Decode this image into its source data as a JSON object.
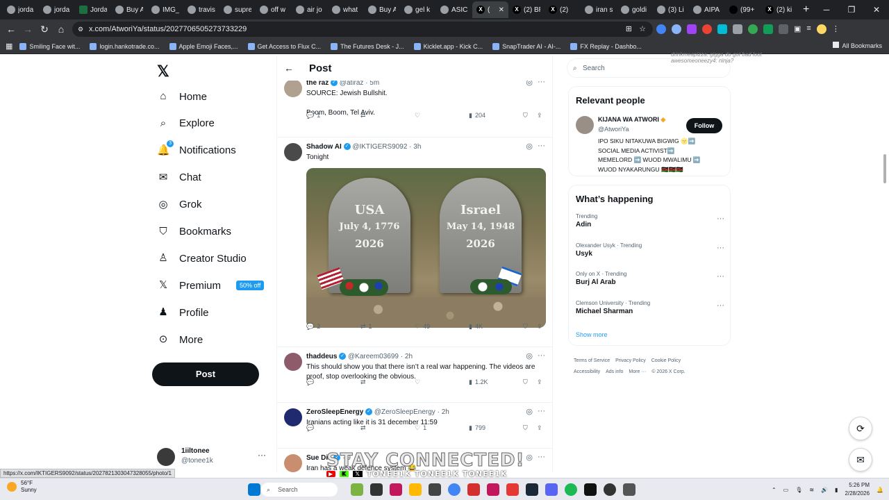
{
  "browser": {
    "tabs": [
      {
        "label": "jorda",
        "icon": "chrome-icon"
      },
      {
        "label": "jorda",
        "icon": "chrome-icon"
      },
      {
        "label": "Jorda",
        "icon": "excel-icon"
      },
      {
        "label": "Buy A",
        "icon": "tab-icon"
      },
      {
        "label": "IMG_",
        "icon": "chrome-icon"
      },
      {
        "label": "travis",
        "icon": "chrome-icon"
      },
      {
        "label": "supre",
        "icon": "chrome-icon"
      },
      {
        "label": "off w",
        "icon": "chrome-icon"
      },
      {
        "label": "air jo",
        "icon": "chrome-icon"
      },
      {
        "label": "what",
        "icon": "chrome-icon"
      },
      {
        "label": "Buy A",
        "icon": "tab-icon"
      },
      {
        "label": "gel k",
        "icon": "chrome-icon"
      },
      {
        "label": "ASIC",
        "icon": "tab-icon"
      },
      {
        "label": "(",
        "icon": "x-icon",
        "active": true
      },
      {
        "label": "(2) BR",
        "icon": "x-icon"
      },
      {
        "label": "(2) ",
        "icon": "x-icon"
      },
      {
        "label": "iran s",
        "icon": "chrome-icon"
      },
      {
        "label": "goldi",
        "icon": "chrome-icon"
      },
      {
        "label": "(3) Li",
        "icon": "tab-icon"
      },
      {
        "label": "AIPA",
        "icon": "chrome-icon"
      },
      {
        "label": "(99+",
        "icon": "tiktok-icon"
      },
      {
        "label": "(2) ki",
        "icon": "x-icon"
      }
    ],
    "url": "x.com/AtworiYa/status/2027706505273733229",
    "bookmarks": [
      "Smiling Face wit...",
      "login.hankotrade.co...",
      "Apple Emoji Faces,...",
      "Get Access to Flux C...",
      "The Futures Desk - J...",
      "Kicklet.app - Kick C...",
      "SnapTrader AI - AI-...",
      "FX Replay - Dashbo..."
    ],
    "all_bookmarks": "All Bookmarks",
    "status_url": "https://x.com/IKTIGERS9092/status/2027821303047328055/photo/1",
    "ghost_lines": [
      "drinkmeapizza: gigga do got bad loot",
      "awesomeoneezy4: ninja?"
    ]
  },
  "nav": {
    "items": [
      {
        "label": "Home",
        "icon": "home-icon"
      },
      {
        "label": "Explore",
        "icon": "search-icon"
      },
      {
        "label": "Notifications",
        "icon": "bell-icon",
        "badge": "3"
      },
      {
        "label": "Chat",
        "icon": "mail-icon"
      },
      {
        "label": "Grok",
        "icon": "grok-icon"
      },
      {
        "label": "Bookmarks",
        "icon": "bookmark-icon"
      },
      {
        "label": "Creator Studio",
        "icon": "creator-icon"
      },
      {
        "label": "Premium",
        "icon": "x-icon",
        "badge": "50% off"
      },
      {
        "label": "Profile",
        "icon": "person-icon"
      },
      {
        "label": "More",
        "icon": "more-icon"
      }
    ],
    "post_button": "Post",
    "account": {
      "name": "1iiltonee",
      "handle": "@toneе1k"
    }
  },
  "main": {
    "title": "Post",
    "tweets": [
      {
        "name": "the raz",
        "handle": "@atiraz · 5m",
        "lines": [
          "SOURCE: Jewish Bullshit.",
          "",
          "Boom, Boom, Tel Aviv."
        ],
        "replies": "1",
        "reposts": "",
        "likes": "",
        "views": "204"
      },
      {
        "name": "Shadow AI",
        "handle": "@IKTIGERS9092 · 3h",
        "lines": [
          "Tonight"
        ],
        "replies": "2",
        "reposts": "1",
        "likes": "49",
        "views": "4K"
      },
      {
        "name": "thaddeus",
        "handle": "@Kareem03699 · 2h",
        "lines": [
          "This should show you that there isn’t a real war happening. The videos are",
          "proof, stop overlooking the obvious."
        ],
        "replies": "",
        "reposts": "",
        "likes": "",
        "views": "1.2K"
      },
      {
        "name": "ZeroSleepEnergy",
        "handle": "@ZeroSleepEnergy · 2h",
        "lines": [
          "Iranians acting like it is 31 december 11:59"
        ],
        "replies": "",
        "reposts": "",
        "likes": "1",
        "views": "799"
      },
      {
        "name": "Sue Dia",
        "handle": "· 9",
        "lines": [
          "Iran has a weak defence system 😂"
        ],
        "replies": "",
        "reposts": "",
        "likes": "",
        "views": ""
      }
    ],
    "image": {
      "left": {
        "country": "USA",
        "date": "July 4, 1776",
        "year": "2026"
      },
      "right": {
        "country": "Israel",
        "date": "May 14, 1948",
        "year": "2026"
      }
    }
  },
  "sidebar": {
    "search_placeholder": "Search",
    "relevant_title": "Relevant people",
    "person": {
      "name": "KIJANA WA ATWORI",
      "handle": "@AtworiYa",
      "follow": "Follow",
      "bio": [
        "IPO SIKU NITAKUWA BIGWIG 🌝➡️",
        "SOCIAL MEDIA ACTIVIST➡️",
        "MEMELORD ➡️ WUOD MWALIMU ➡️",
        "WUOD NYAKARUNGU 🇰🇪🇰🇪🇰🇪"
      ]
    },
    "happening_title": "What’s happening",
    "trends": [
      {
        "context": "Trending",
        "name": "Adin"
      },
      {
        "context": "Olexander Usyk · Trending",
        "name": "Usyk"
      },
      {
        "context": "Only on X · Trending",
        "name": "Burj Al Arab"
      },
      {
        "context": "Clemson University · Trending",
        "name": "Michael Sharman"
      }
    ],
    "show_more": "Show more",
    "footer": [
      "Terms of Service",
      "Privacy Policy",
      "Cookie Policy",
      "Accessibility",
      "Ads info",
      "More ···",
      "© 2026 X Corp."
    ]
  },
  "overlay": {
    "text": "STAY CONNECTED!",
    "names": "TONEE1K   TONEE1K   TONEE1K"
  },
  "taskbar": {
    "weather_temp": "56°F",
    "weather_desc": "Sunny",
    "search": "Search",
    "time": "5:26 PM",
    "date": "2/28/2026"
  },
  "colors": {
    "accent": "#1d9bf0",
    "text": "#0f1419",
    "muted": "#536471"
  }
}
